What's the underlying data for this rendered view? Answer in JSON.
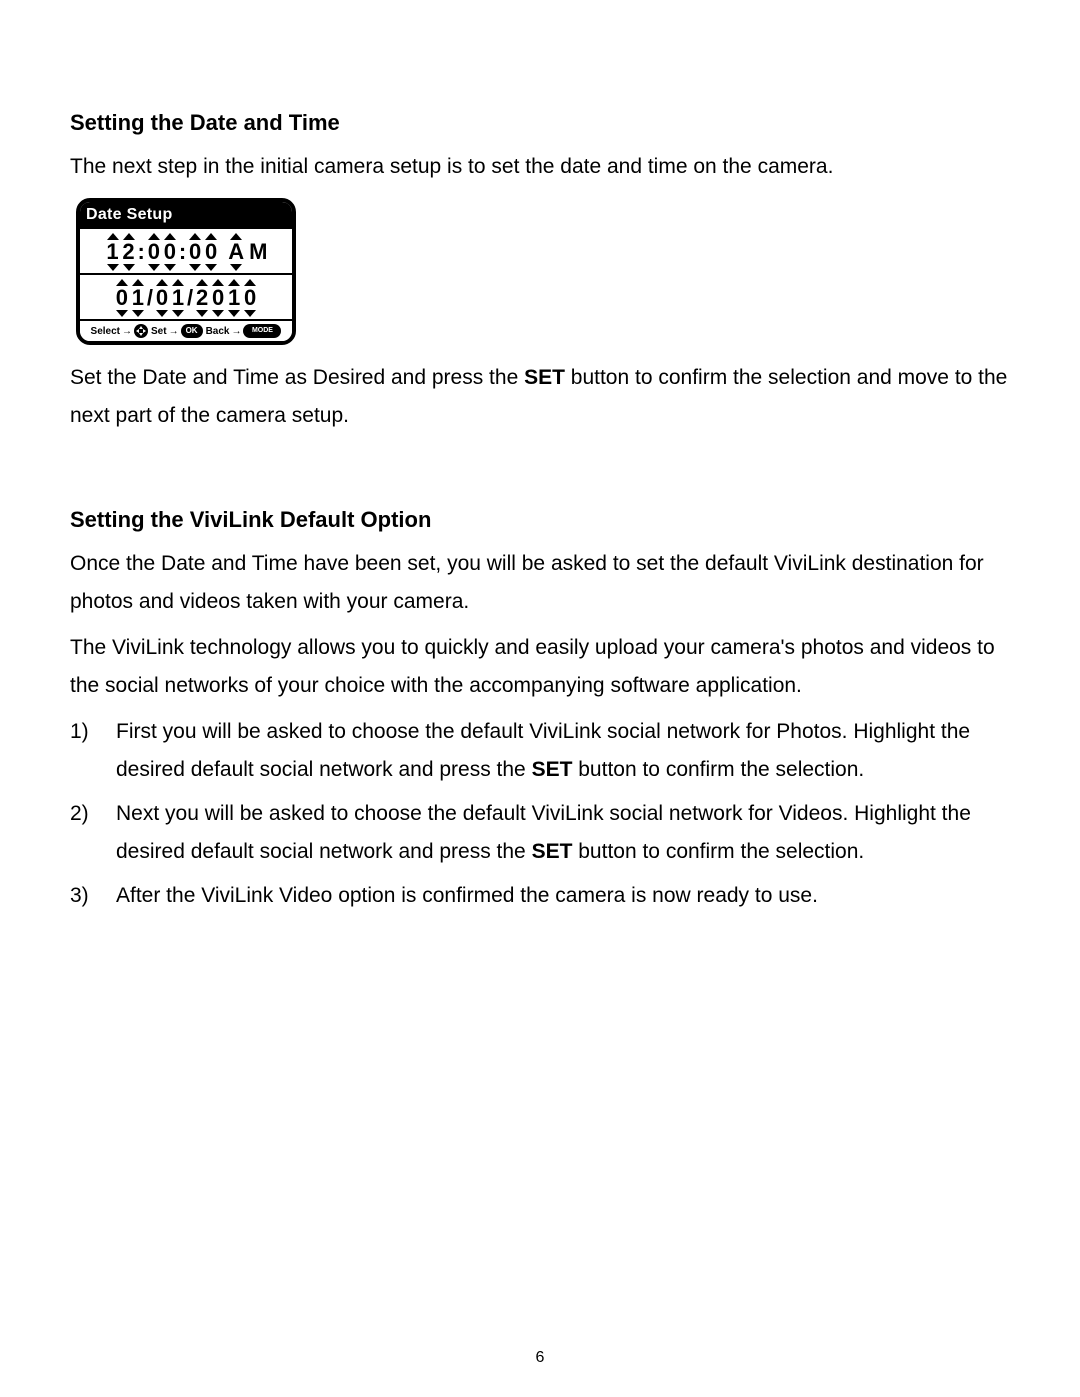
{
  "section1": {
    "title": "Setting the Date and Time",
    "intro": "The next step in the initial camera setup is to set the date and time on the camera.",
    "after_img_pre": "Set the Date and Time as Desired and press the ",
    "after_img_bold": "SET",
    "after_img_post": " button to confirm the selection and move to the next part of the camera setup."
  },
  "lcd": {
    "title": "Date Setup",
    "time_h1": "1",
    "time_h2": "2",
    "time_m1": "0",
    "time_m2": "0",
    "time_s1": "0",
    "time_s2": "0",
    "ampm_a": "A",
    "ampm_m": "M",
    "date_m1": "0",
    "date_m2": "1",
    "date_d1": "0",
    "date_d2": "1",
    "date_y1": "2",
    "date_y2": "0",
    "date_y3": "1",
    "date_y4": "0",
    "footer_select": "Select",
    "footer_set": "Set",
    "footer_back": "Back",
    "pill_ok": "OK",
    "pill_mode": "MODE"
  },
  "section2": {
    "title": "Setting the ViviLink Default Option",
    "p1": "Once the Date and Time have been set, you will be asked to set the default ViviLink destination for photos and videos taken with your camera.",
    "p2": "The ViviLink technology allows you to quickly and easily upload your camera's photos and videos to the social networks of your choice with the accompanying software application.",
    "items": [
      {
        "num": "1)",
        "pre": "First you will be asked to choose the default ViviLink social network for Photos. Highlight the desired default social network and press the ",
        "bold": "SET",
        "post": " button to confirm the selection."
      },
      {
        "num": "2)",
        "pre": "Next you will be asked to choose the default ViviLink social network for Videos. Highlight the desired default social network and press the ",
        "bold": "SET",
        "post": " button to confirm the selection."
      },
      {
        "num": "3)",
        "pre": "After the ViviLink Video option is confirmed the camera is now ready to use.",
        "bold": "",
        "post": ""
      }
    ]
  },
  "page_number": "6"
}
